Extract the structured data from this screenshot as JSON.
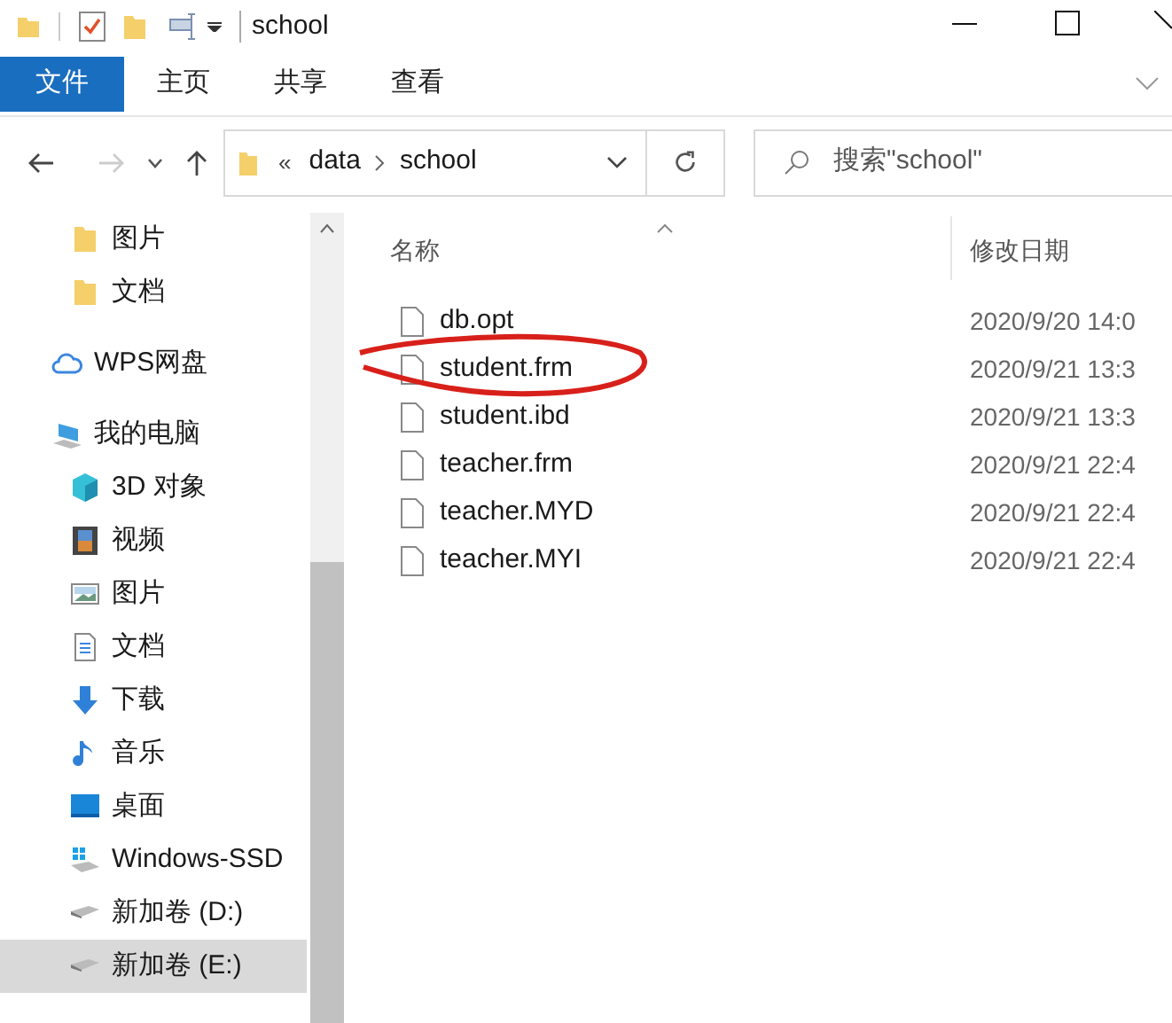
{
  "window": {
    "title": "school"
  },
  "ribbon_tabs": [
    {
      "label": "文件",
      "selected": true
    },
    {
      "label": "主页",
      "selected": false
    },
    {
      "label": "共享",
      "selected": false
    },
    {
      "label": "查看",
      "selected": false
    }
  ],
  "address": {
    "overflow": "«",
    "path": [
      "data",
      "school"
    ],
    "search_placeholder": "搜索\"school\""
  },
  "quick_access_items": [
    {
      "label": "图片",
      "kind": "folder",
      "selected": false
    },
    {
      "label": "文档",
      "kind": "folder",
      "selected": false
    }
  ],
  "nav": [
    {
      "label": "WPS网盘",
      "kind": "cloud",
      "selected": false
    },
    {
      "label": "我的电脑",
      "kind": "computer",
      "selected": false,
      "children": [
        {
          "label": "3D 对象",
          "kind": "cube",
          "selected": false
        },
        {
          "label": "视频",
          "kind": "film",
          "selected": false
        },
        {
          "label": "图片",
          "kind": "image",
          "selected": false
        },
        {
          "label": "文档",
          "kind": "document",
          "selected": false
        },
        {
          "label": "下载",
          "kind": "download",
          "selected": false
        },
        {
          "label": "音乐",
          "kind": "music",
          "selected": false
        },
        {
          "label": "桌面",
          "kind": "desktop",
          "selected": false
        },
        {
          "label": "Windows-SSD",
          "kind": "windrive",
          "selected": false
        },
        {
          "label": "新加卷 (D:)",
          "kind": "drive",
          "selected": false
        },
        {
          "label": "新加卷 (E:)",
          "kind": "drive",
          "selected": true
        }
      ]
    }
  ],
  "table": {
    "columns": [
      "名称",
      "修改日期"
    ],
    "rows": [
      {
        "name": "db.opt",
        "modified": "2020/9/20 14:0",
        "circled": false
      },
      {
        "name": "student.frm",
        "modified": "2020/9/21 13:3",
        "circled": true
      },
      {
        "name": "student.ibd",
        "modified": "2020/9/21 13:3",
        "circled": false
      },
      {
        "name": "teacher.frm",
        "modified": "2020/9/21 22:4",
        "circled": false
      },
      {
        "name": "teacher.MYD",
        "modified": "2020/9/21 22:4",
        "circled": false
      },
      {
        "name": "teacher.MYI",
        "modified": "2020/9/21 22:4",
        "circled": false
      }
    ]
  }
}
